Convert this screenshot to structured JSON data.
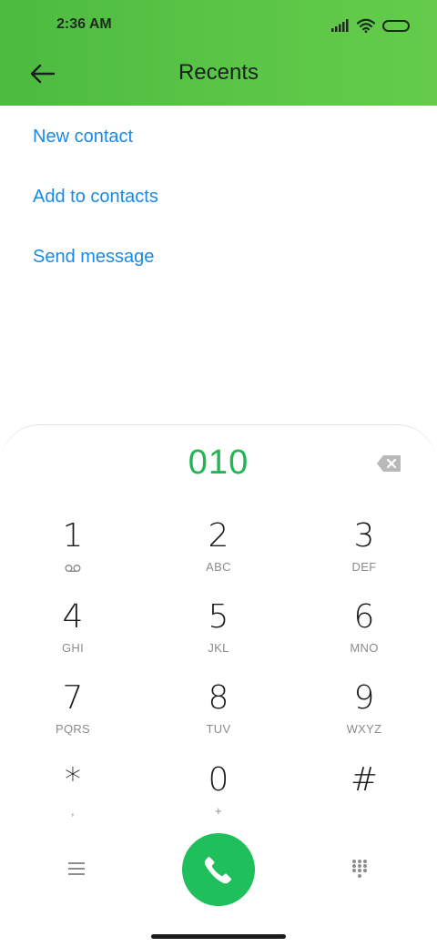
{
  "status_bar": {
    "time": "2:36 AM"
  },
  "header": {
    "title": "Recents"
  },
  "actions": [
    "New contact",
    "Add to contacts",
    "Send message"
  ],
  "dialer": {
    "number": "010",
    "keys": [
      {
        "digit": "1",
        "letters": ""
      },
      {
        "digit": "2",
        "letters": "ABC"
      },
      {
        "digit": "3",
        "letters": "DEF"
      },
      {
        "digit": "4",
        "letters": "GHI"
      },
      {
        "digit": "5",
        "letters": "JKL"
      },
      {
        "digit": "6",
        "letters": "MNO"
      },
      {
        "digit": "7",
        "letters": "PQRS"
      },
      {
        "digit": "8",
        "letters": "TUV"
      },
      {
        "digit": "9",
        "letters": "WXYZ"
      },
      {
        "digit": "*",
        "letters": ","
      },
      {
        "digit": "0",
        "letters": "+"
      },
      {
        "digit": "#",
        "letters": ""
      }
    ]
  },
  "colors": {
    "header_green": "#5cc648",
    "link_blue": "#1a8ae4",
    "number_green": "#22b455",
    "call_green": "#1fbf5b"
  },
  "icons": {
    "back": "arrow-left-icon",
    "signal": "signal-icon",
    "wifi": "wifi-icon",
    "battery": "battery-icon",
    "backspace": "backspace-icon",
    "voicemail": "voicemail-icon",
    "menu": "menu-icon",
    "call": "phone-icon",
    "keypad": "keypad-icon"
  }
}
